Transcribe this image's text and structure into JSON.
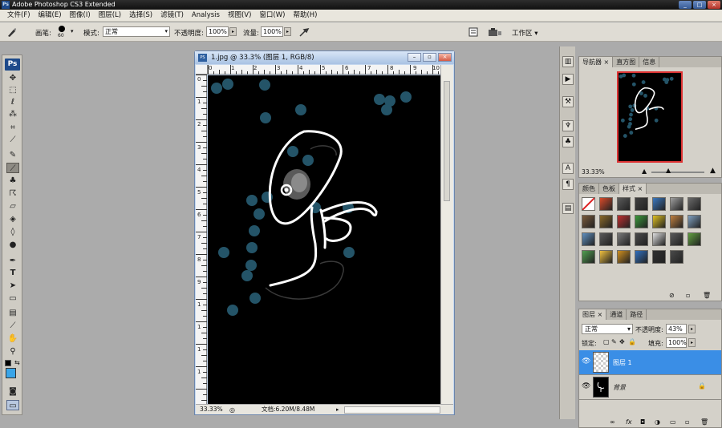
{
  "titlebar": {
    "title": "Adobe Photoshop CS3 Extended",
    "logo": "Ps",
    "min": "_",
    "max": "□",
    "close": "×"
  },
  "menu": [
    "文件(F)",
    "编辑(E)",
    "图像(I)",
    "图层(L)",
    "选择(S)",
    "滤镜(T)",
    "Analysis",
    "视图(V)",
    "窗口(W)",
    "帮助(H)"
  ],
  "options": {
    "brush_label": "画笔:",
    "brush_size": "60",
    "mode_label": "模式:",
    "mode_value": "正常",
    "opacity_label": "不透明度:",
    "opacity_value": "100%",
    "flow_label": "流量:",
    "flow_value": "100%",
    "workspace_label": "工作区 ▾"
  },
  "tools": {
    "badge": "Ps"
  },
  "document": {
    "title": "1.jpg @ 33.3% (图层 1, RGB/8)",
    "icon": "PS",
    "ruler_top": [
      "0",
      "1",
      "2",
      "3",
      "4",
      "5",
      "6",
      "7",
      "8",
      "9",
      "10"
    ],
    "ruler_left": [
      "0",
      "1",
      "2",
      "3",
      "4",
      "5",
      "6",
      "7",
      "8",
      "9",
      "1",
      "1",
      "1",
      "1"
    ],
    "status_zoom": "33.33%",
    "status_doc": "文档:6.20M/8.48M",
    "btn_min": "–",
    "btn_max": "▫",
    "btn_close": "×"
  },
  "navigator": {
    "tabs": [
      "导航器",
      "直方图",
      "信息"
    ],
    "zoom": "33.33%"
  },
  "styles": {
    "tabs": [
      "颜色",
      "色板",
      "样式"
    ],
    "swatch_colors": [
      "#ffffff",
      "#d94a2a",
      "#5a5a5a",
      "#404040",
      "#3a78c0",
      "#a0a0a0",
      "#6a6a6a",
      "#7a5a3a",
      "#8a6a2a",
      "#c03030",
      "#3a9a3a",
      "#e0c020",
      "#c08040",
      "#80a0c0",
      "#6090c0",
      "#5a5a5a",
      "#7a7a7a",
      "#4a4a4a",
      "#e0e0e0",
      "#5a5a5a",
      "#60a040",
      "#50a050",
      "#f0c040",
      "#d09020",
      "#3070c0",
      "#303030",
      "#4a4a4a"
    ]
  },
  "layers": {
    "tabs": [
      "图层",
      "通道",
      "路径"
    ],
    "blend": "正常",
    "opacity_label": "不透明度:",
    "opacity": "43%",
    "lock_label": "锁定:",
    "fill_label": "填充:",
    "fill": "100%",
    "items": [
      {
        "name": "图层 1",
        "selected": true
      },
      {
        "name": "背景",
        "selected": false
      }
    ]
  },
  "colors": {
    "accent": "#3aa5e8",
    "selection": "#3a8ee6",
    "dots": "#245468"
  }
}
